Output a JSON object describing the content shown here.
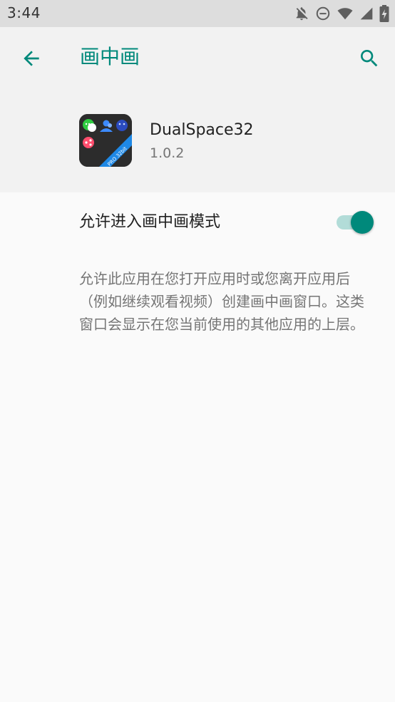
{
  "status_bar": {
    "time": "3:44",
    "icons": [
      "notifications-off-icon",
      "do-not-disturb-icon",
      "wifi-icon",
      "signal-icon",
      "battery-charging-icon"
    ]
  },
  "header": {
    "title": "画中画",
    "back_icon": "arrow-back-icon",
    "search_icon": "search-icon",
    "accent_color": "#00897b"
  },
  "app": {
    "name": "DualSpace32",
    "version": "1.0.2",
    "icon_badge": "PRO 32bit"
  },
  "setting": {
    "label": "允许进入画中画模式",
    "enabled": true
  },
  "description": "允许此应用在您打开应用时或您离开应用后（例如继续观看视频）创建画中画窗口。这类窗口会显示在您当前使用的其他应用的上层。"
}
